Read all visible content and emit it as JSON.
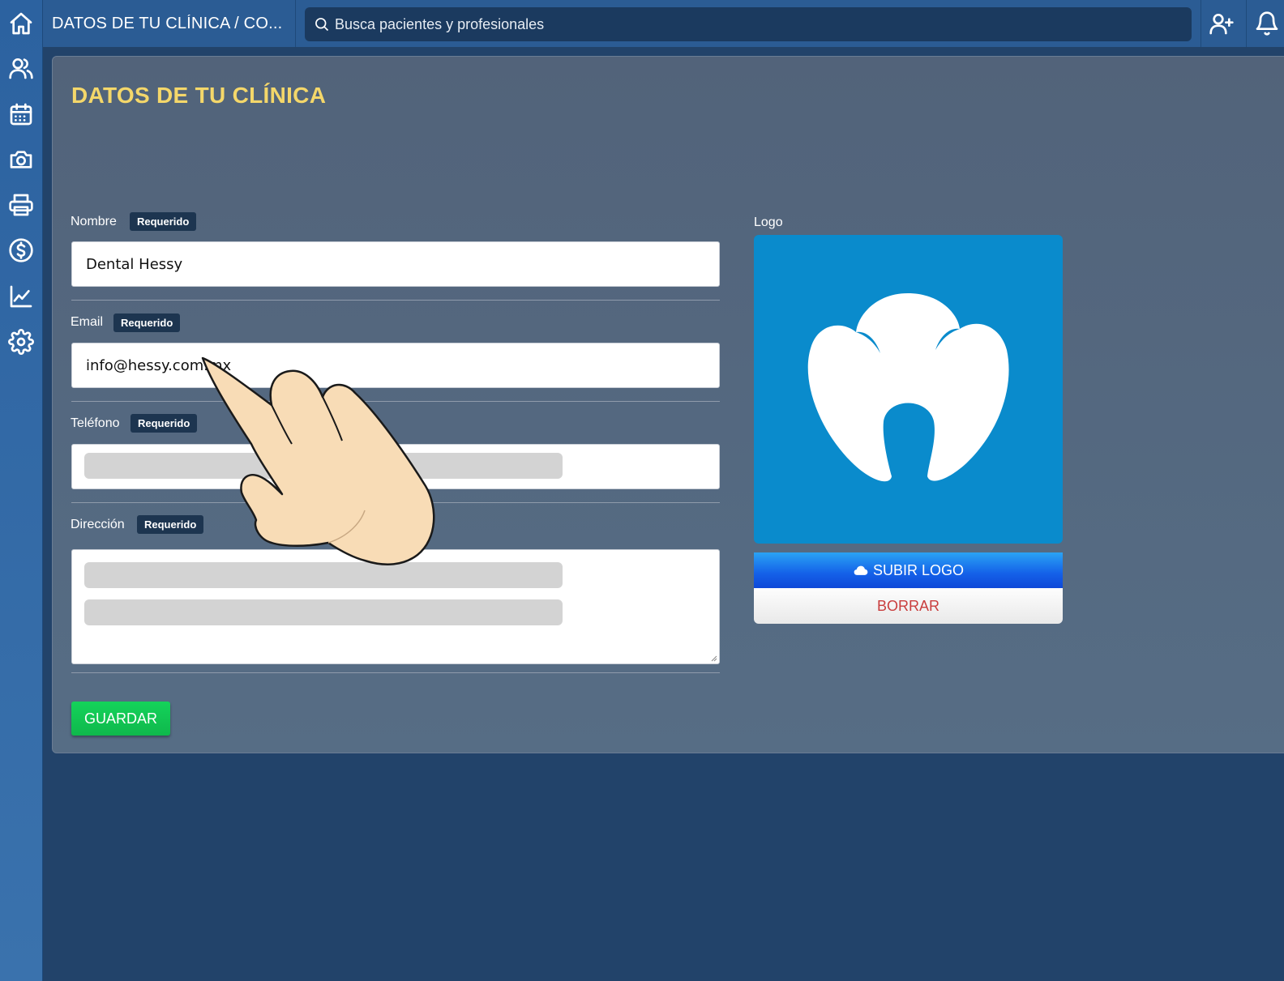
{
  "header": {
    "title": "DATOS DE TU CLÍNICA / CO...",
    "search_placeholder": "Busca pacientes y profesionales"
  },
  "sidebar": {
    "items": [
      {
        "icon": "home-icon"
      },
      {
        "icon": "users-icon"
      },
      {
        "icon": "calendar-icon"
      },
      {
        "icon": "camera-icon"
      },
      {
        "icon": "printer-icon"
      },
      {
        "icon": "dollar-icon"
      },
      {
        "icon": "chart-icon"
      },
      {
        "icon": "gear-icon"
      }
    ]
  },
  "form": {
    "title": "DATOS DE TU CLÍNICA",
    "required_badge": "Requerido",
    "name": {
      "label": "Nombre",
      "value": "Dental Hessy"
    },
    "email": {
      "label": "Email",
      "value": "info@hessy.com.mx"
    },
    "phone": {
      "label": "Teléfono",
      "value": ""
    },
    "address": {
      "label": "Dirección",
      "value": ""
    },
    "save_label": "GUARDAR"
  },
  "logo": {
    "label": "Logo",
    "upload_label": "SUBIR LOGO",
    "delete_label": "BORRAR"
  },
  "colors": {
    "accent_title": "#f4d76a",
    "save_green": "#14d35a",
    "upload_blue": "#1460e8",
    "delete_red": "#c93d3d",
    "logo_bg": "#0a8bcc"
  }
}
